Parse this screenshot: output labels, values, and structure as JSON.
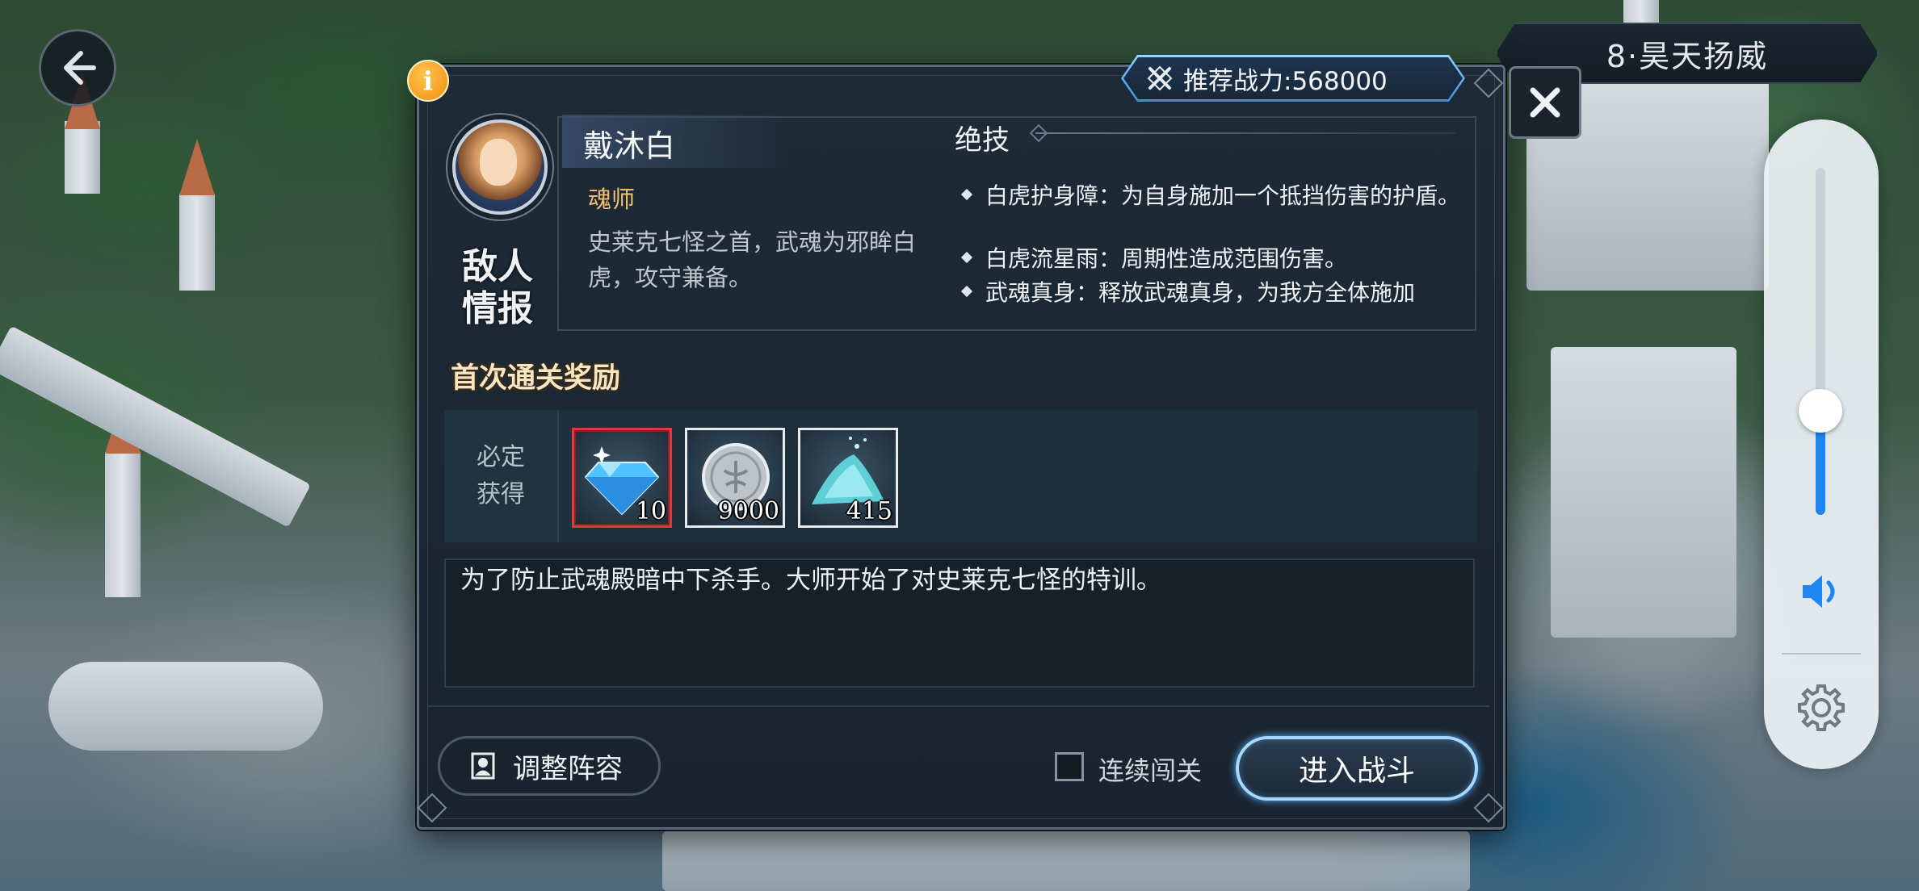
{
  "stage": {
    "title": "8·昊天扬威"
  },
  "dialog": {
    "power_label": "推荐战力:568000",
    "info_badge": "i",
    "enemy": {
      "section_title": "敌人情报",
      "name": "戴沐白",
      "class": "魂师",
      "description": "史莱克七怪之首，武魂为邪眸白虎，攻守兼备。"
    },
    "skills": {
      "title": "绝技",
      "items": [
        "白虎护身障：为自身施加一个抵挡伤害的护盾。",
        "白虎流星雨：周期性造成范围伤害。",
        "武魂真身：释放武魂真身，为我方全体施加"
      ]
    },
    "reward": {
      "title": "首次通关奖励",
      "label": "必定获得",
      "items": [
        {
          "icon": "diamond-icon",
          "count": "10"
        },
        {
          "icon": "silver-coin-icon",
          "count": "9000"
        },
        {
          "icon": "crystal-dust-icon",
          "count": "415"
        }
      ]
    },
    "story": "为了防止武魂殿暗中下杀手。大师开始了对史莱克七怪的特训。",
    "buttons": {
      "lineup": "调整阵容",
      "continuous_label": "连续闯关",
      "battle": "进入战斗"
    }
  },
  "volume": {
    "level": 0.3
  },
  "colors": {
    "accent_blue": "#1d86f0",
    "gold": "#f0c070",
    "rare_border": "#d83c3c"
  }
}
